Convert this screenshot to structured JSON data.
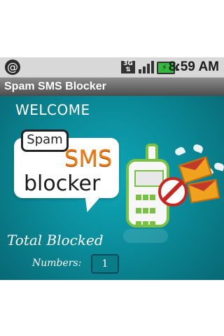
{
  "status": {
    "time": "8:59 AM",
    "network": "3G"
  },
  "titlebar": {
    "title": "Spam SMS Blocker"
  },
  "main": {
    "welcome": "WELCOME",
    "logo": {
      "spam": "Spam",
      "sms": "SMS",
      "blocker": "blocker"
    },
    "total_blocked_label": "Total Blocked",
    "numbers_label": "Numbers:",
    "numbers_value": "1"
  },
  "colors": {
    "teal_bg": "#0b8d9c",
    "accent_orange": "#f07b10",
    "phone_green": "#7ac143",
    "no_entry_red": "#c9241f"
  },
  "icons": [
    "at-icon",
    "3g-icon",
    "signal-icon",
    "battery-icon",
    "phone-icon",
    "no-entry-icon",
    "envelope-icon"
  ]
}
